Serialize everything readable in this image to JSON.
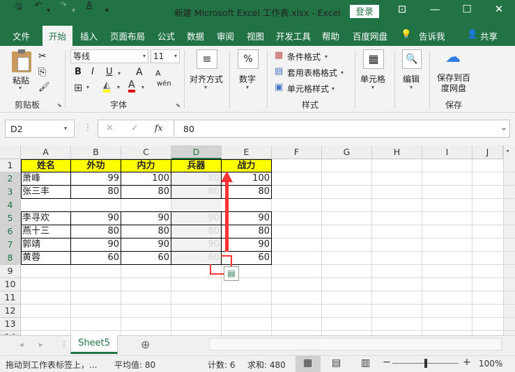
{
  "titlebar": {
    "title": "新建 Microsoft Excel 工作表.xlsx  -  Excel",
    "login": "登录",
    "save_icon": "save-icon",
    "undo_icon": "undo-icon",
    "redo_icon": "redo-icon",
    "font_color_icon": "font-color-icon",
    "customize_icon": "customize-icon",
    "ribbon_display_icon": "ribbon-display-icon",
    "minimize_icon": "minimize-icon",
    "maximize_icon": "maximize-icon",
    "close_icon": "close-icon",
    "qa_glyphs": {
      "save": "🖫",
      "undo": "↶",
      "undo_dd": "▾",
      "redo": "↷",
      "redo_dd": "▾",
      "font": "A",
      "customize": "▾"
    },
    "win_glyphs": {
      "ribbon": "⊡",
      "min": "—",
      "max": "☐",
      "close": "✕"
    }
  },
  "ribbon_tabs": [
    "文件",
    "开始",
    "插入",
    "页面布局",
    "公式",
    "数据",
    "审阅",
    "视图",
    "开发工具",
    "帮助",
    "百度网盘"
  ],
  "tell_me": "告诉我",
  "share": "共享",
  "tab_glyphs": {
    "tell_me": "💡",
    "share": "👤"
  },
  "ribbon": {
    "paste": "粘贴",
    "clipboard": "剪贴板",
    "font_name": "等线",
    "font_size": "11",
    "bold": "B",
    "italic": "I",
    "underline": "U",
    "grow_font": "A",
    "shrink_font": "A",
    "phonetic": "wén",
    "font_group": "字体",
    "align": "对齐方式",
    "number": "数字",
    "number_symbol": "%",
    "cond_format": "条件格式",
    "table_format": "套用表格格式",
    "cell_style": "单元格样式",
    "styles_group": "样式",
    "cells": "单元格",
    "edit": "编辑",
    "save_to_baidu": "保存到百度网盘",
    "save_group": "保存",
    "glyphs": {
      "launcher": "⬊",
      "dropdown": "▾",
      "cut": "✂",
      "copy": "⎘",
      "painter": "🖌",
      "border": "⊞",
      "fill": "◭",
      "font_color": "A",
      "cells": "▦",
      "edit": "🔍",
      "cloud": "☁",
      "cond_format": "▦",
      "table_format": "▤",
      "cell_style": "▣",
      "align": "≡"
    }
  },
  "formula_bar": {
    "cell_ref": "D2",
    "formula": "80",
    "cancel": "✕",
    "enter": "✓",
    "fx": "fx",
    "dots": "⋮",
    "expand": "⌄"
  },
  "grid": {
    "columns": [
      "A",
      "B",
      "C",
      "D",
      "E",
      "F",
      "G",
      "H",
      "I",
      "J"
    ],
    "rows": [
      "1",
      "2",
      "3",
      "4",
      "5",
      "6",
      "7",
      "8",
      "9",
      "10",
      "11",
      "12",
      "13",
      "14"
    ],
    "headers": [
      "姓名",
      "外功",
      "内力",
      "兵器",
      "战力"
    ],
    "data": [
      [
        "萧峰",
        "99",
        "100",
        "80",
        "100"
      ],
      [
        "张三丰",
        "80",
        "80",
        "80",
        "80"
      ],
      [
        "",
        "",
        "",
        "",
        ""
      ],
      [
        "李寻欢",
        "90",
        "90",
        "90",
        "90"
      ],
      [
        "燕十三",
        "80",
        "80",
        "80",
        "80"
      ],
      [
        "郭靖",
        "90",
        "90",
        "90",
        "90"
      ],
      [
        "黄蓉",
        "60",
        "60",
        "60",
        "60"
      ]
    ],
    "selected_cell": "D2",
    "quick_analysis_icon": "quick-analysis-icon",
    "quick_analysis_glyph": "▤",
    "drag_arrow_color": "#ff3333"
  },
  "sheets": {
    "tabs": [
      "Sheet5"
    ],
    "add": "⊕",
    "prev": "◂",
    "next": "▸",
    "dots": "⋮"
  },
  "status": {
    "message": "拖动到工作表标签上，...",
    "average": "平均值: 80",
    "count": "计数: 6",
    "sum": "求和: 480",
    "zoom": "100%",
    "zoom_minus": "−",
    "zoom_plus": "+",
    "view_icons": [
      "normal-view-icon",
      "page-layout-view-icon",
      "page-break-view-icon"
    ],
    "view_glyphs": [
      "▦",
      "▤",
      "▥"
    ]
  },
  "colors": {
    "brand": "#217346",
    "header_fill": "#ffff00",
    "arrow": "#ff3333"
  }
}
